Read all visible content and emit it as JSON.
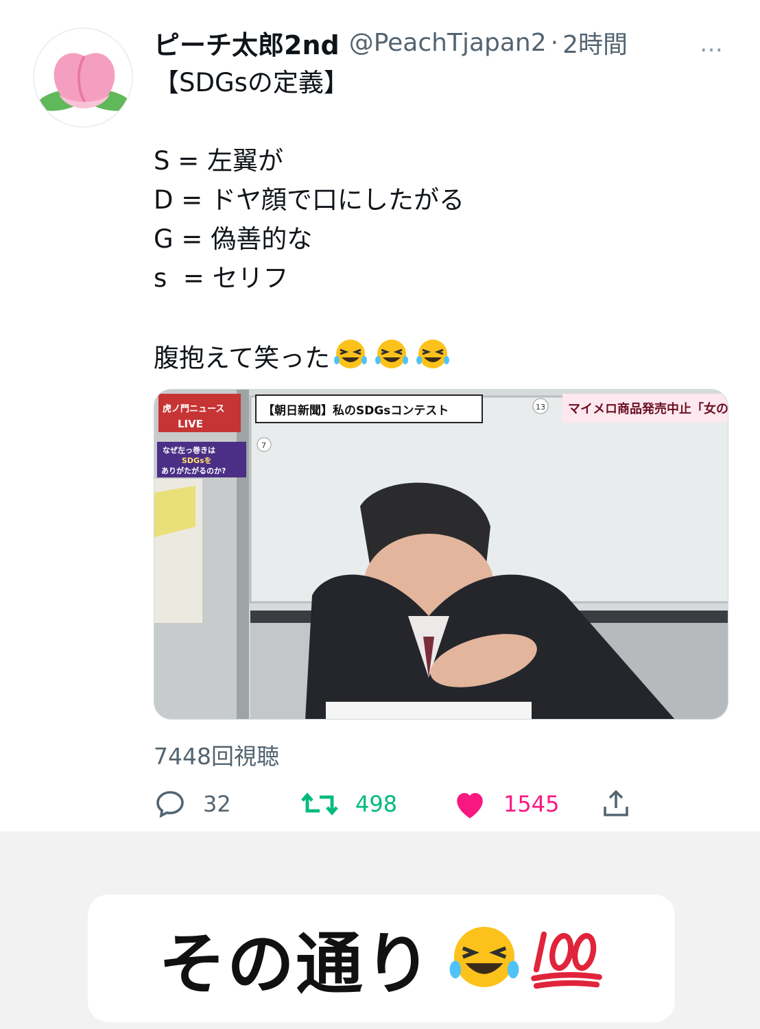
{
  "tweet": {
    "display_name": "ピーチ太郎2nd",
    "handle": "@PeachTjapan2",
    "separator": "·",
    "time": "2時間",
    "more_icon": "…",
    "text_lines": [
      "【SDGsの定義】",
      "",
      "S = 左翼が",
      "D = ドヤ顔で口にしたがる",
      "G = 偽善的な",
      "s  = セリフ",
      "",
      "腹抱えて笑った"
    ],
    "trailing_emoji": "rolling-on-floor-laughing x3",
    "video": {
      "overlay_caption": "【朝日新聞】私のSDGsコンテスト",
      "overlay_right": "マイメロ商品発売中止「女の敵は女",
      "logo_lines": [
        "虎ノ門ニュース",
        "LIVE"
      ],
      "badge_lines": [
        "なぜ左っ巻きは",
        "SDGsを",
        "ありがたがるのか?"
      ],
      "number_right": "13",
      "number_left": "7"
    },
    "views": "7448回視聴",
    "stats": {
      "replies": "32",
      "retweets": "498",
      "likes": "1545"
    },
    "colors": {
      "retweet": "#00ba7c",
      "like": "#f91880",
      "muted": "#536471"
    }
  },
  "caption": {
    "text": "その通り",
    "emojis": [
      "rolling-on-floor-laughing",
      "hundred-points"
    ]
  }
}
